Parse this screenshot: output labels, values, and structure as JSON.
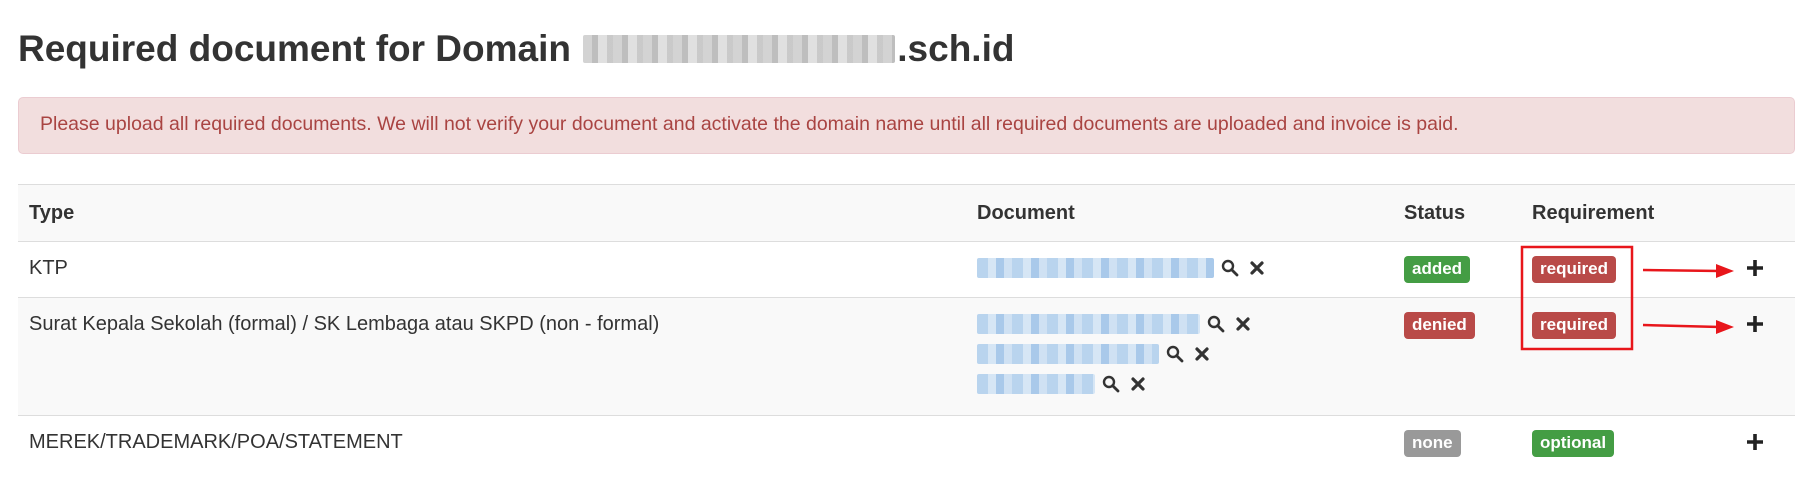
{
  "page": {
    "title_prefix": "Required document for Domain",
    "title_suffix": ".sch.id"
  },
  "alert": {
    "message": "Please upload all required documents. We will not verify your document and activate the domain name until all required documents are uploaded and invoice is paid.",
    "color": "#a94442",
    "background": "#f2dede"
  },
  "table": {
    "headers": {
      "type": "Type",
      "document": "Document",
      "status": "Status",
      "requirement": "Requirement"
    },
    "rows": [
      {
        "type": "KTP",
        "documents_count": 1,
        "status": "added",
        "requirement": "required"
      },
      {
        "type": "Surat Kepala Sekolah (formal) / SK Lembaga atau SKPD (non - formal)",
        "documents_count": 3,
        "status": "denied",
        "requirement": "required"
      },
      {
        "type": "MEREK/TRADEMARK/POA/STATEMENT",
        "documents_count": 0,
        "status": "none",
        "requirement": "optional"
      }
    ]
  },
  "colors": {
    "added": "#449d44",
    "denied": "#b94a48",
    "none": "#999999",
    "optional": "#449d44",
    "required": "#b94a48",
    "annotation": "#e8161b"
  },
  "icons": {
    "view": "magnifier-icon",
    "delete": "x-mark-icon",
    "add": "plus-icon"
  }
}
